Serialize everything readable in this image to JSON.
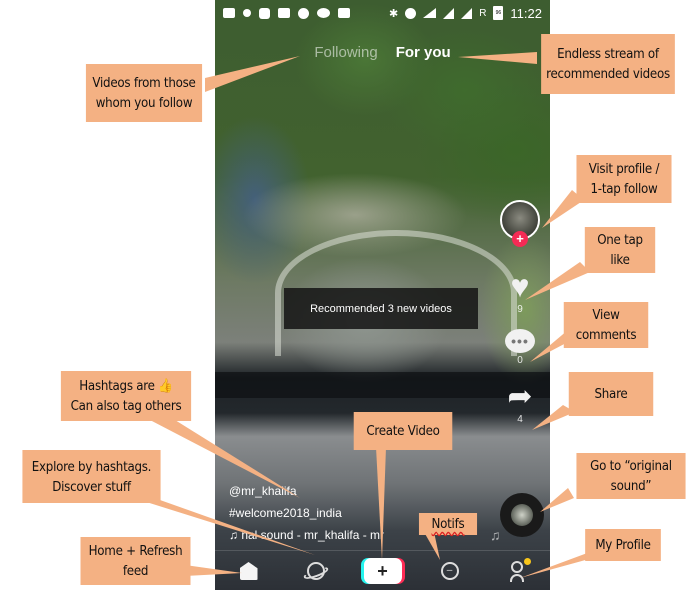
{
  "status_bar": {
    "left_icons": [
      "message-icon",
      "notification-icon",
      "app-icon",
      "clapper-icon",
      "star-icon",
      "video-icon",
      "youtube-icon"
    ],
    "right_icons": [
      "bluetooth-icon",
      "do-not-disturb-icon",
      "wifi-icon",
      "signal-icon",
      "signal-x-icon"
    ],
    "roaming": "R",
    "battery": "96",
    "time": "11:22"
  },
  "feed_tabs": {
    "following": "Following",
    "for_you": "For you",
    "active": "For you"
  },
  "toast": "Recommended 3 new videos",
  "actions": {
    "follow_plus": "+",
    "likes": "9",
    "comments": "0",
    "shares": "4",
    "comment_glyph": "•••"
  },
  "caption": {
    "username": "@mr_khalifa",
    "hashtag": "#welcome2018_india",
    "sound": "♫ nal sound - mr_khalifa - mr"
  },
  "nav": {
    "items": [
      {
        "name": "home",
        "icon": "home-icon"
      },
      {
        "name": "discover",
        "icon": "planet-icon"
      },
      {
        "name": "create",
        "icon": "plus-icon",
        "label": "+"
      },
      {
        "name": "inbox",
        "icon": "message-icon"
      },
      {
        "name": "me",
        "icon": "profile-icon"
      }
    ]
  },
  "callouts": {
    "following": "Videos from those whom you follow",
    "following_l1": "Videos from those",
    "following_l2": "whom you follow",
    "for_you_l1": "Endless stream of",
    "for_you_l2": "recommended videos",
    "profile_l1": "Visit profile /",
    "profile_l2": "1-tap follow",
    "like_l1": "One tap",
    "like_l2": "like",
    "comments_l1": "View",
    "comments_l2": "comments",
    "share": "Share",
    "sound_l1": "Go to “original",
    "sound_l2": "sound”",
    "hashtags_l1": "Hashtags are 👍",
    "hashtags_l2": "Can also tag others",
    "explore_l1": "Explore by hashtags.",
    "explore_l2": "Discover stuff",
    "home_l1": "Home + Refresh",
    "home_l2": "feed",
    "create": "Create  Video",
    "notifs": "Notifs",
    "my_profile": "My Profile"
  },
  "colors": {
    "callout_bg": "#f4b183",
    "follow_red": "#f42b55",
    "notif_dot": "#f8c61b",
    "create_cyan": "#25f4ee",
    "create_pink": "#fe2c55"
  }
}
